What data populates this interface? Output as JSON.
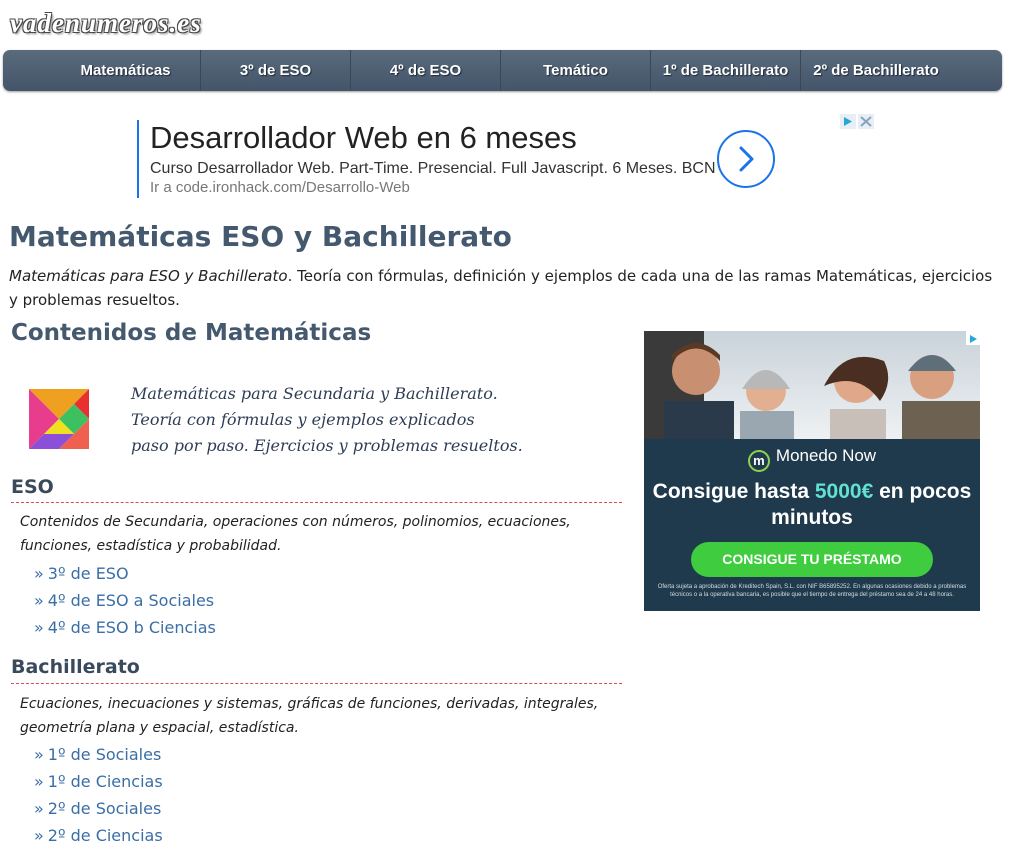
{
  "site": {
    "logo": "vadenumeros.es"
  },
  "nav": {
    "items": [
      {
        "label": "Matemáticas"
      },
      {
        "label": "3º de ESO"
      },
      {
        "label": "4º de ESO"
      },
      {
        "label": "Temático"
      },
      {
        "label": "1º de Bachillerato"
      },
      {
        "label": "2º de Bachillerato"
      }
    ]
  },
  "text_ad": {
    "title": "Desarrollador Web en 6 meses",
    "description": "Curso Desarrollador Web. Part-Time. Presencial. Full Javascript. 6 Meses. BCN",
    "url": "Ir a code.ironhack.com/Desarrollo-Web"
  },
  "main": {
    "title": "Matemáticas ESO y Bachillerato",
    "intro_em": "Matemáticas para ESO y Bachillerato",
    "intro_rest": ". Teoría con fórmulas, definición y ejemplos de cada una de las ramas Matemáticas, ejercicios y problemas resueltos.",
    "contents_title": "Contenidos de Matemáticas",
    "script_lines": [
      "Matemáticas para Secundaria y Bachillerato.",
      "Teoría con fórmulas y ejemplos explicados",
      "paso por paso. Ejercicios y problemas resueltos."
    ],
    "link_marker": "»",
    "sections": [
      {
        "title": "ESO",
        "description": "Contenidos de Secundaria, operaciones con números, polinomios, ecuaciones, funciones, estadística y probabilidad.",
        "links": [
          "3º de ESO",
          "4º de ESO a Sociales",
          "4º de ESO b Ciencias"
        ]
      },
      {
        "title": "Bachillerato",
        "description": "Ecuaciones, inecuaciones y sistemas, gráficas de funciones, derivadas, integrales, geometría plana y espacial, estadística.",
        "links": [
          "1º de Sociales",
          "1º de Ciencias",
          "2º de Sociales",
          "2º de Ciencias"
        ]
      }
    ]
  },
  "display_ad": {
    "brand_mark": "m",
    "brand": "Monedo Now",
    "headline_before": "Consigue hasta ",
    "headline_highlight": "5000€",
    "headline_after": " en pocos minutos",
    "cta": "CONSIGUE TU PRÉSTAMO",
    "fine_print": "Oferta sujeta a aprobación de Kreditech Spain, S.L. con NIF B65895252. En algunas ocasiones debido a problemas técnicos o a la operativa bancaria, es posible que el tiempo de entrega del préstamo sea de 24 a 48 horas."
  },
  "colors": {
    "nav_bg": "#4a5a6e",
    "heading": "#44586e",
    "link": "#3a6ea5",
    "ad_accent": "#1a73e8",
    "rule": "#d25050",
    "ad_bg": "#1f3a4c",
    "cta": "#3fcd3f",
    "highlight": "#62e0d0"
  }
}
